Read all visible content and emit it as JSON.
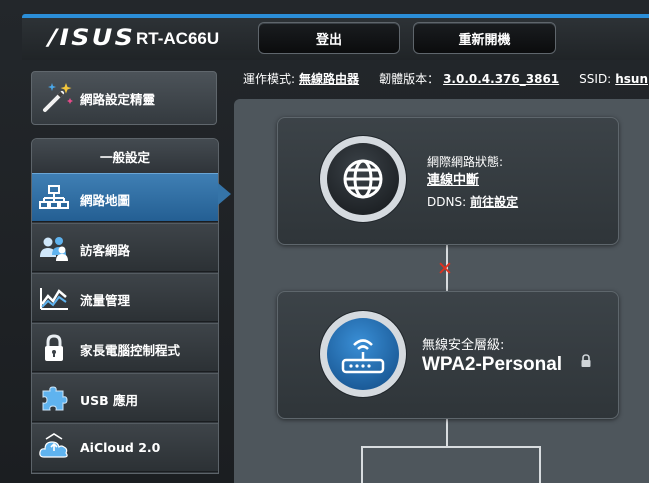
{
  "header": {
    "brand": "/ISUS",
    "model": "RT-AC66U",
    "logout_label": "登出",
    "reboot_label": "重新開機"
  },
  "status": {
    "mode_label": "運作模式:",
    "mode_value": "無線路由器",
    "firmware_label": "韌體版本：",
    "firmware_value": "3.0.0.4.376_3861",
    "ssid_label": "SSID:",
    "ssid_value": "hsun"
  },
  "sidebar": {
    "wizard_label": "網路設定精靈",
    "section_title": "一般設定",
    "items": [
      {
        "label": "網路地圖",
        "icon": "network-map-icon",
        "active": true
      },
      {
        "label": "訪客網路",
        "icon": "guest-network-icon",
        "active": false
      },
      {
        "label": "流量管理",
        "icon": "traffic-manager-icon",
        "active": false
      },
      {
        "label": "家長電腦控制程式",
        "icon": "parental-control-lock-icon",
        "active": false
      },
      {
        "label": "USB 應用",
        "icon": "usb-puzzle-icon",
        "active": false
      },
      {
        "label": "AiCloud 2.0",
        "icon": "aicloud-icon",
        "active": false
      }
    ]
  },
  "internet_card": {
    "status_label": "網際網路狀態:",
    "status_value": "連線中斷",
    "ddns_label": "DDNS:",
    "ddns_value": "前往設定"
  },
  "wireless_card": {
    "security_label": "無線安全層級:",
    "security_value": "WPA2-Personal"
  },
  "colors": {
    "accent": "#2b8ed8",
    "active_item": "#3574a8",
    "disconnect": "#e0301e"
  }
}
